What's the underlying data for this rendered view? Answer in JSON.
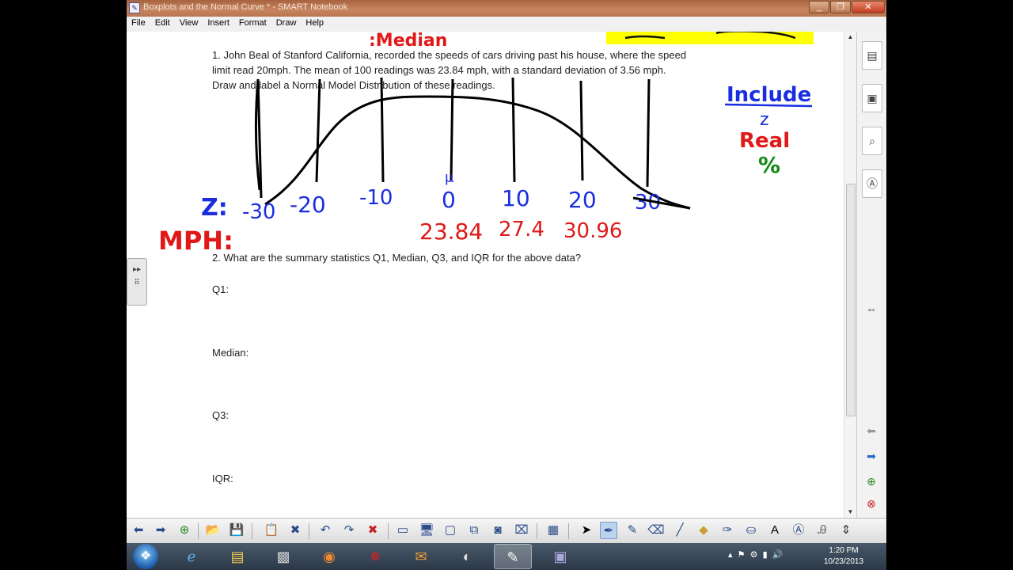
{
  "window": {
    "title": "Boxplots and the Normal Curve * - SMART Notebook",
    "minimize": "_",
    "restore": "❐",
    "close": "✕"
  },
  "menu": [
    "File",
    "Edit",
    "View",
    "Insert",
    "Format",
    "Draw",
    "Help"
  ],
  "document": {
    "q1_line1": "1.  John Beal of Stanford California, recorded the speeds of cars driving past his house, where the speed",
    "q1_line2": "limit read 20mph.  The mean of 100 readings was 23.84 mph, with a standard deviation of 3.56 mph.",
    "q1_line3": "Draw and label a Normal Model Distribution of these readings.",
    "q2": "2.  What are the summary statistics Q1, Median, Q3, and IQR for the above data?",
    "labels": {
      "q1": "Q1:",
      "median": "Median:",
      "q3": "Q3:",
      "iqr": "IQR:"
    }
  },
  "ink": {
    "top_median": ":Median",
    "z_prefix": "Z:",
    "z_labels": [
      "-30",
      "-20",
      "-10",
      "0",
      "10",
      "20",
      "30"
    ],
    "mu": "μ",
    "mph_prefix": "MPH:",
    "mph_values": [
      "23.84",
      "27.4",
      "30.96"
    ],
    "include": "Include",
    "include_z": "z",
    "include_real": "Real",
    "include_pct": "%"
  },
  "colors": {
    "blue_ink": "#1a2ee0",
    "red_ink": "#e01818",
    "green_ink": "#108a10",
    "highlight": "#ffff00"
  },
  "taskbar": {
    "time": "1:20 PM",
    "date": "10/23/2013"
  }
}
